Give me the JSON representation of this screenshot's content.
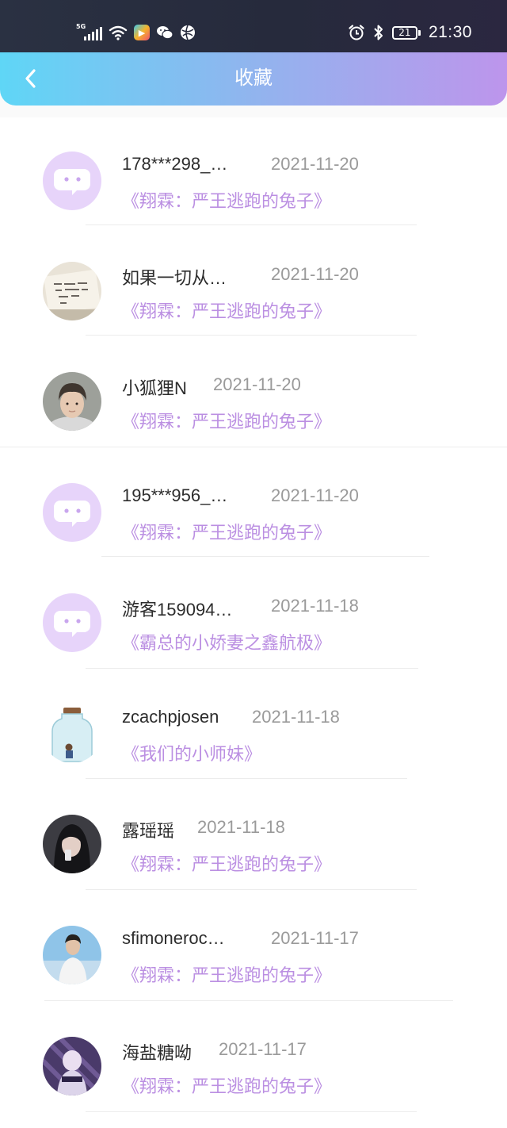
{
  "status_bar": {
    "network": "5G",
    "battery": "21",
    "time": "21:30"
  },
  "header": {
    "title": "收藏"
  },
  "favorites": [
    {
      "user": "178***298_…",
      "date": "2021-11-20",
      "book": "《翔霖：严王逃跑的兔子》",
      "avatar": "default-chat-icon"
    },
    {
      "user": "如果一切从…",
      "date": "2021-11-20",
      "book": "《翔霖：严王逃跑的兔子》",
      "avatar": "handwriting-note-photo"
    },
    {
      "user": "小狐狸N",
      "date": "2021-11-20",
      "book": "《翔霖：严王逃跑的兔子》",
      "avatar": "boy-portrait-photo"
    },
    {
      "user": "195***956_…",
      "date": "2021-11-20",
      "book": "《翔霖：严王逃跑的兔子》",
      "avatar": "default-chat-icon"
    },
    {
      "user": "游客159094…",
      "date": "2021-11-18",
      "book": "《霸总的小娇妻之鑫航极》",
      "avatar": "default-chat-icon"
    },
    {
      "user": "zcachpjosen",
      "date": "2021-11-18",
      "book": "《我们的小师妹》",
      "avatar": "glass-jar-photo"
    },
    {
      "user": "露瑶瑶",
      "date": "2021-11-18",
      "book": "《翔霖：严王逃跑的兔子》",
      "avatar": "girl-selfie-photo"
    },
    {
      "user": "sfimoneroc…",
      "date": "2021-11-17",
      "book": "《翔霖：严王逃跑的兔子》",
      "avatar": "boy-outdoor-photo"
    },
    {
      "user": "海盐糖呦",
      "date": "2021-11-17",
      "book": "《翔霖：严王逃跑的兔子》",
      "avatar": "anime-art-photo"
    }
  ],
  "colors": {
    "header_gradient_start": "#5fd6f6",
    "header_gradient_end": "#bd95ec",
    "book_title": "#bb8fe2",
    "default_avatar_bg": "#e7d4fa",
    "default_avatar_bubble": "#ffffff"
  }
}
